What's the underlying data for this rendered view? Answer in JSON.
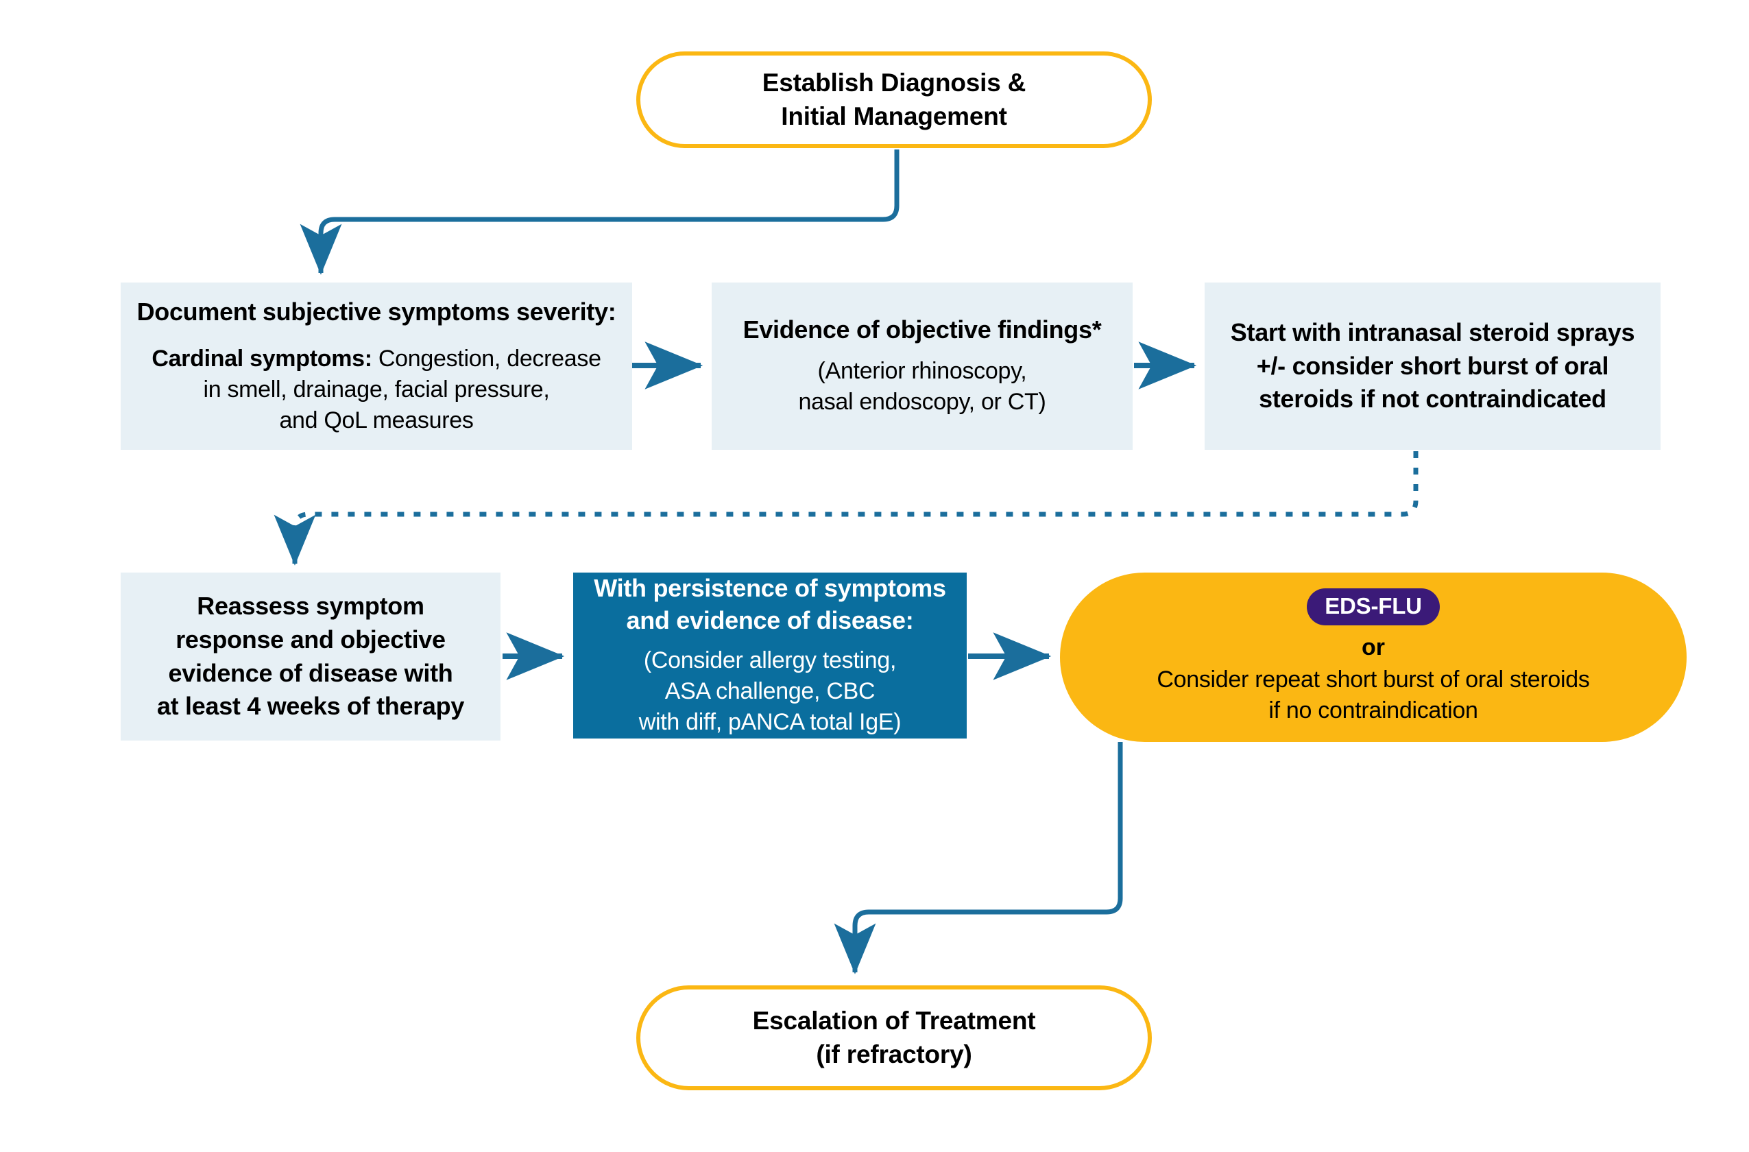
{
  "diagram": {
    "title_flow": "Establish Diagnosis & Initial Management to Escalation of Treatment",
    "colors": {
      "accent_gold": "#FBB713",
      "accent_blue_dark": "#0A6E9E",
      "accent_purple": "#3B1A78",
      "box_light_fill": "#E7F0F5",
      "connector": "#1B6E9C"
    }
  },
  "start_node": {
    "line1": "Establish Diagnosis &",
    "line2": "Initial Management"
  },
  "row1": {
    "document_symptoms": {
      "heading": "Document subjective symptoms severity:",
      "sub_label": "Cardinal symptoms:",
      "sub_line1_rest": " Congestion, decrease",
      "sub_line2": "in smell, drainage, facial pressure,",
      "sub_line3": "and QoL measures"
    },
    "objective_findings": {
      "heading": "Evidence of objective findings*",
      "sub_line1": "(Anterior rhinoscopy,",
      "sub_line2": "nasal endoscopy, or CT)"
    },
    "intranasal_steroids": {
      "line1": "Start with intranasal steroid sprays",
      "line2": "+/- consider short burst of oral",
      "line3": "steroids if not contraindicated"
    }
  },
  "row2": {
    "reassess": {
      "line1": "Reassess symptom",
      "line2": "response and objective",
      "line3": "evidence of disease with",
      "line4": "at least 4 weeks of therapy"
    },
    "persistence": {
      "heading_line1": "With persistence of symptoms",
      "heading_line2": "and evidence of disease:",
      "sub_line1": "(Consider allergy testing,",
      "sub_line2": "ASA challenge, CBC",
      "sub_line3": "with diff, pANCA total IgE)"
    },
    "treatment_option": {
      "badge": "EDS-FLU",
      "or": "or",
      "desc_line1": "Consider repeat short burst of oral steroids",
      "desc_line2": "if no contraindication"
    }
  },
  "end_node": {
    "line1": "Escalation of Treatment",
    "line2": "(if refractory)"
  }
}
